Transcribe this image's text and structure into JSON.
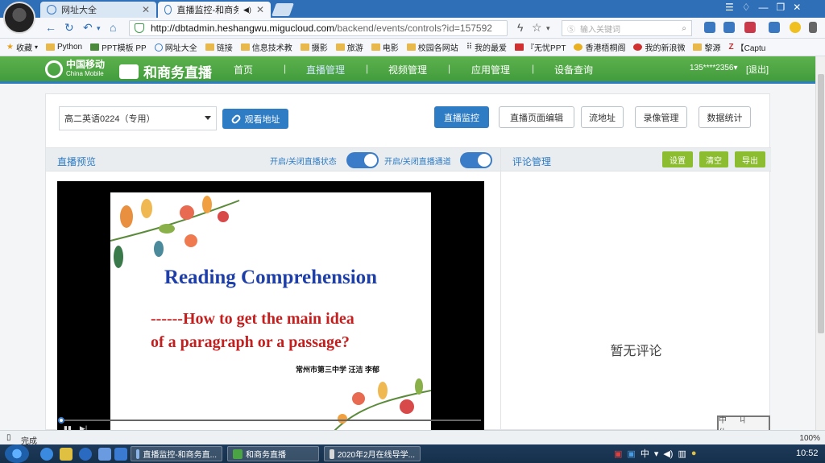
{
  "browser": {
    "tabs": [
      {
        "label": "网址大全",
        "active": false
      },
      {
        "label": "直播监控-和商务直播",
        "active": true
      }
    ],
    "url_host": "http://dbtadmin.heshangwu.migucloud.com",
    "url_path": "/backend/events/controls?id=157592",
    "search_placeholder": "输入关键词",
    "bookmarks": [
      "收藏",
      "Python",
      "PPT模板 PP",
      "网址大全",
      "链接",
      "信息技术教",
      "摄影",
      "旅游",
      "电影",
      "校园各网站",
      "我的最爱",
      "『无忧PPT",
      "香港梧桐阁",
      "我的新浪微",
      "黎源",
      "【Captu"
    ],
    "status_text": "完成",
    "zoom": "100%"
  },
  "site": {
    "logo_main": "中国移动",
    "logo_sub": "China Mobile",
    "logo_product": "和商务直播",
    "nav": [
      {
        "label": "首页",
        "active": false
      },
      {
        "label": "直播管理",
        "active": true
      },
      {
        "label": "视频管理",
        "active": false
      },
      {
        "label": "应用管理",
        "active": false
      },
      {
        "label": "设备查询",
        "active": false
      }
    ],
    "user": "135****2356▾",
    "logout": "[退出]"
  },
  "controls": {
    "select_value": "高二英语0224（专用）",
    "watch_button": "观看地址",
    "buttons": [
      "直播监控",
      "直播页面编辑",
      "流地址",
      "录像管理",
      "数据统计"
    ]
  },
  "preview": {
    "title": "直播预览",
    "toggle1_label": "开启/关闭直播状态",
    "toggle2_label": "开启/关闭直播通道",
    "toggle1_on": true,
    "toggle2_on": true
  },
  "slide": {
    "title": "Reading Comprehension",
    "line1": "------How to get the main idea",
    "line2": "of a paragraph or a  passage?",
    "author": "常州市第三中学  汪洁  李郁"
  },
  "comments": {
    "title": "评论管理",
    "buttons": [
      "设置",
      "清空",
      "导出"
    ],
    "empty_text": "暂无评论"
  },
  "stamp": "中 ㄐ 仆",
  "taskbar": {
    "tasks": [
      "直播监控-和商务直...",
      "和商务直播",
      "2020年2月在线导学..."
    ],
    "time": "10:52",
    "tray_lang": "中"
  },
  "colors": {
    "brand_green": "#4aa443",
    "accent_blue": "#2e7cc4",
    "action_green": "#8cbc2f"
  }
}
